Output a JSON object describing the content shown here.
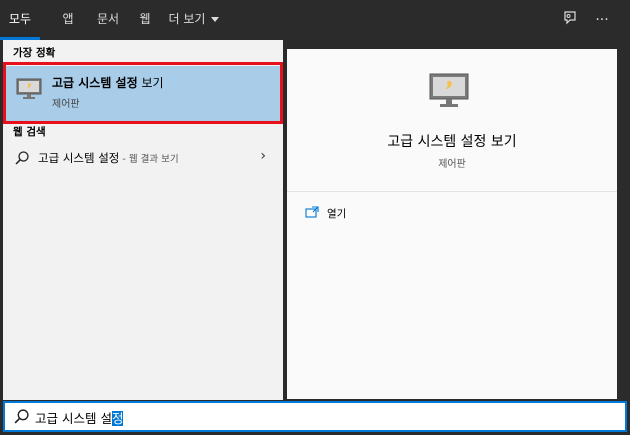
{
  "tabs": [
    {
      "label": "모두",
      "active": true
    },
    {
      "label": "앱",
      "active": false
    },
    {
      "label": "문서",
      "active": false
    },
    {
      "label": "웹",
      "active": false
    },
    {
      "label": "더 보기",
      "active": false
    }
  ],
  "top_icons": [
    "feedback-icon",
    "more-options-icon"
  ],
  "left": {
    "best_match_heading": "가장 정확",
    "best_match": {
      "title_bold": "고급 시스템 설정",
      "title_rest": " 보기",
      "subtitle": "제어판",
      "icon": "control-panel-icon"
    },
    "web_heading": "웹 검색",
    "web_result": {
      "text": "고급 시스템 설정",
      "hint": " - 웹 결과 보기"
    }
  },
  "preview": {
    "title": "고급 시스템 설정 보기",
    "subtitle": "제어판",
    "actions": [
      {
        "label": "열기",
        "icon": "open-icon"
      }
    ]
  },
  "search": {
    "typed": "고급 시스템 설",
    "selected": "정"
  },
  "colors": {
    "accent": "#0078d7",
    "highlight": "#a9cde9",
    "annotation_box": "#e8101a"
  }
}
